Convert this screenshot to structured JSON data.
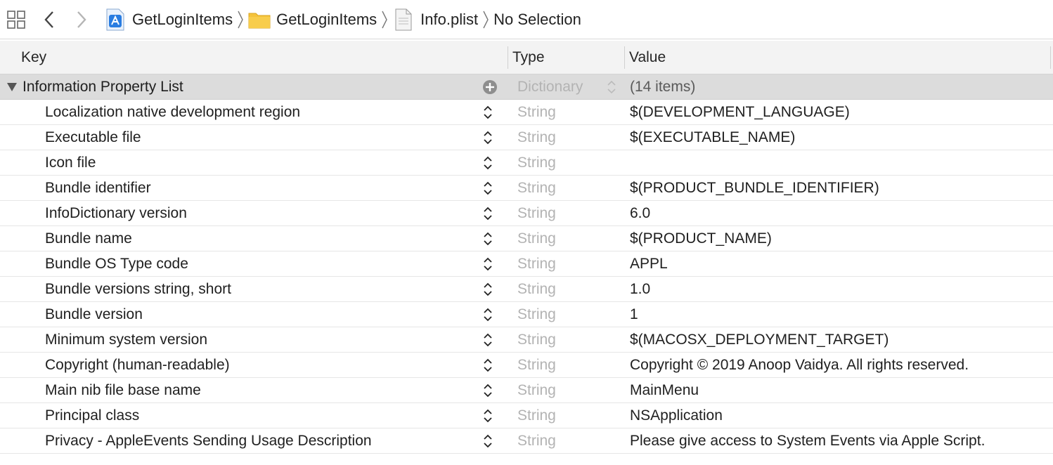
{
  "breadcrumb": {
    "items": [
      {
        "label": "GetLoginItems",
        "icon": "xcode-project-icon"
      },
      {
        "label": "GetLoginItems",
        "icon": "folder-icon"
      },
      {
        "label": "Info.plist",
        "icon": "plist-file-icon"
      },
      {
        "label": "No Selection",
        "icon": ""
      }
    ]
  },
  "columns": {
    "key": "Key",
    "type": "Type",
    "value": "Value"
  },
  "root": {
    "key": "Information Property List",
    "type": "Dictionary",
    "value": "(14 items)"
  },
  "rows": [
    {
      "key": "Localization native development region",
      "type": "String",
      "value": "$(DEVELOPMENT_LANGUAGE)"
    },
    {
      "key": "Executable file",
      "type": "String",
      "value": "$(EXECUTABLE_NAME)"
    },
    {
      "key": "Icon file",
      "type": "String",
      "value": ""
    },
    {
      "key": "Bundle identifier",
      "type": "String",
      "value": "$(PRODUCT_BUNDLE_IDENTIFIER)"
    },
    {
      "key": "InfoDictionary version",
      "type": "String",
      "value": "6.0"
    },
    {
      "key": "Bundle name",
      "type": "String",
      "value": "$(PRODUCT_NAME)"
    },
    {
      "key": "Bundle OS Type code",
      "type": "String",
      "value": "APPL"
    },
    {
      "key": "Bundle versions string, short",
      "type": "String",
      "value": "1.0"
    },
    {
      "key": "Bundle version",
      "type": "String",
      "value": "1"
    },
    {
      "key": "Minimum system version",
      "type": "String",
      "value": "$(MACOSX_DEPLOYMENT_TARGET)"
    },
    {
      "key": "Copyright (human-readable)",
      "type": "String",
      "value": "Copyright © 2019 Anoop Vaidya. All rights reserved."
    },
    {
      "key": "Main nib file base name",
      "type": "String",
      "value": "MainMenu"
    },
    {
      "key": "Principal class",
      "type": "String",
      "value": "NSApplication"
    },
    {
      "key": "Privacy - AppleEvents Sending Usage Description",
      "type": "String",
      "value": "Please give access to System Events via Apple Script."
    }
  ],
  "colors": {
    "folder": "#f5c33b",
    "type_text": "#b3b3b3",
    "root_row": "#dcdcdc",
    "xcode_blue": "#2a7de1"
  }
}
